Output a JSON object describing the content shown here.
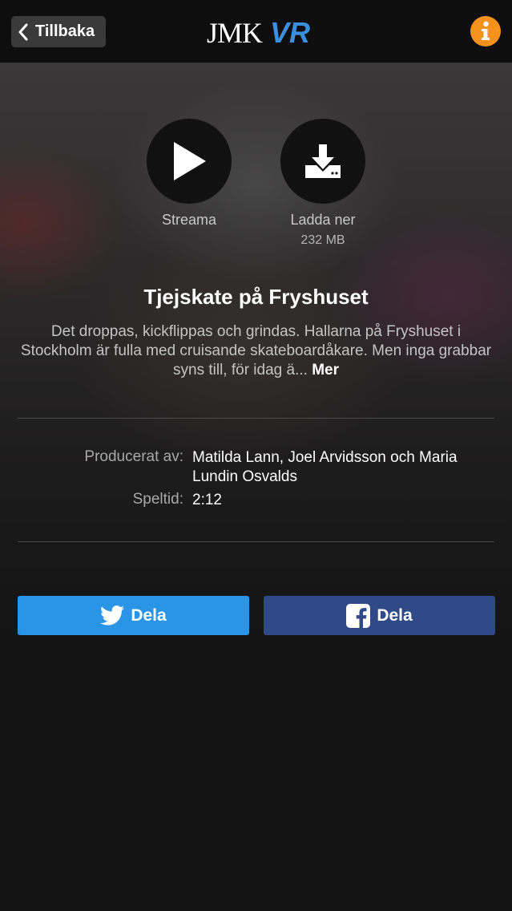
{
  "header": {
    "back_label": "Tillbaka",
    "logo_text": "JMK",
    "logo_accent": "VR",
    "logo_accent_color": "#3b8fe0",
    "info_icon": "info-icon",
    "info_color": "#f5921e"
  },
  "actions": {
    "stream": {
      "label": "Streama",
      "icon": "play-icon"
    },
    "download": {
      "label": "Ladda ner",
      "size": "232 MB",
      "icon": "download-icon"
    }
  },
  "video": {
    "title": "Tjejskate på Fryshuset",
    "description": "Det droppas, kickflippas och grindas. Hallarna på Fryshuset i Stockholm är fulla med cruisande skateboardåkare. Men inga grabbar syns till, för idag ä...",
    "more_label": "Mer"
  },
  "meta": {
    "producer_label": "Producerat av:",
    "producer_value": "Matilda Lann, Joel Arvidsson och Maria Lundin Osvalds",
    "duration_label": "Speltid:",
    "duration_value": "2:12"
  },
  "share": {
    "twitter_label": "Dela",
    "twitter_color": "#2a94e6",
    "facebook_label": "Dela",
    "facebook_color": "#2f4a87"
  }
}
